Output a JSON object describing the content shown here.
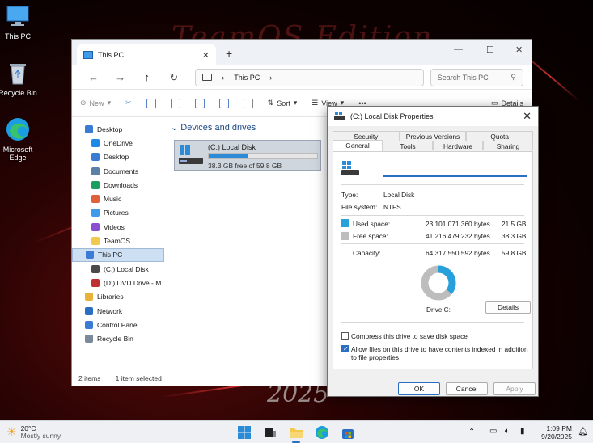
{
  "desktop": {
    "icons": [
      {
        "label": "This PC"
      },
      {
        "label": "Recycle Bin"
      },
      {
        "label": "Microsoft Edge"
      }
    ],
    "wallpaper_text": "TeamOS Edition",
    "wallpaper_year": "2025"
  },
  "explorer": {
    "tab_title": "This PC",
    "address": "This PC",
    "search_placeholder": "Search This PC",
    "commands": {
      "new": "New",
      "sort": "Sort",
      "view": "View",
      "more": "•••",
      "details": "Details"
    },
    "sidebar": [
      {
        "label": "Desktop",
        "icon": "desktop-icon",
        "color": "#3a7bd5"
      },
      {
        "label": "OneDrive",
        "icon": "cloud-icon",
        "color": "#1e88e5"
      },
      {
        "label": "Desktop",
        "icon": "desktop-icon",
        "color": "#3a7bd5"
      },
      {
        "label": "Documents",
        "icon": "document-icon",
        "color": "#5c7fa8"
      },
      {
        "label": "Downloads",
        "icon": "download-icon",
        "color": "#1c9e5e"
      },
      {
        "label": "Music",
        "icon": "music-icon",
        "color": "#e0603a"
      },
      {
        "label": "Pictures",
        "icon": "pictures-icon",
        "color": "#3d9be9"
      },
      {
        "label": "Videos",
        "icon": "videos-icon",
        "color": "#8a4fd0"
      },
      {
        "label": "TeamOS",
        "icon": "folder-icon",
        "color": "#f4c84a"
      },
      {
        "label": "This PC",
        "icon": "computer-icon",
        "color": "#3a7bd5"
      },
      {
        "label": "(C:) Local Disk",
        "icon": "drive-icon",
        "color": "#4a4a4a"
      },
      {
        "label": "(D:) DVD Drive - M",
        "icon": "dvd-icon",
        "color": "#c03030"
      },
      {
        "label": "Libraries",
        "icon": "library-icon",
        "color": "#e8b23a"
      },
      {
        "label": "Network",
        "icon": "network-icon",
        "color": "#2b6fc3"
      },
      {
        "label": "Control Panel",
        "icon": "control-panel-icon",
        "color": "#3a7bd5"
      },
      {
        "label": "Recycle Bin",
        "icon": "recycle-bin-icon",
        "color": "#7a8a9a"
      }
    ],
    "section_title": "Devices and drives",
    "drive": {
      "name": "(C:) Local Disk",
      "free_text": "38.3 GB free of 59.8 GB",
      "used_fraction": 0.36
    },
    "status": {
      "items": "2 items",
      "selected": "1 item selected"
    }
  },
  "properties": {
    "title": "(C:) Local Disk Properties",
    "tabs_top": [
      "Security",
      "Previous Versions",
      "Quota"
    ],
    "tabs_bottom": [
      "General",
      "Tools",
      "Hardware",
      "Sharing"
    ],
    "active_tab": "General",
    "name_value": "",
    "type_label": "Type:",
    "type_value": "Local Disk",
    "fs_label": "File system:",
    "fs_value": "NTFS",
    "used_label": "Used space:",
    "used_bytes": "23,101,071,360 bytes",
    "used_gb": "21.5 GB",
    "free_label": "Free space:",
    "free_bytes": "41,216,479,232 bytes",
    "free_gb": "38.3 GB",
    "cap_label": "Capacity:",
    "cap_bytes": "64,317,550,592 bytes",
    "cap_gb": "59.8 GB",
    "used_fraction": 0.36,
    "drive_label": "Drive C:",
    "details_button": "Details",
    "compress_label": "Compress this drive to save disk space",
    "compress_checked": false,
    "index_label": "Allow files on this drive to have contents indexed in addition to file properties",
    "index_checked": true,
    "ok": "OK",
    "cancel": "Cancel",
    "apply": "Apply",
    "colors": {
      "used": "#27a0db",
      "free": "#bdbdbd",
      "accent": "#2b6fc3"
    }
  },
  "taskbar": {
    "temp": "20°C",
    "condition": "Mostly sunny",
    "time": "1:09 PM",
    "date": "9/20/2025"
  }
}
